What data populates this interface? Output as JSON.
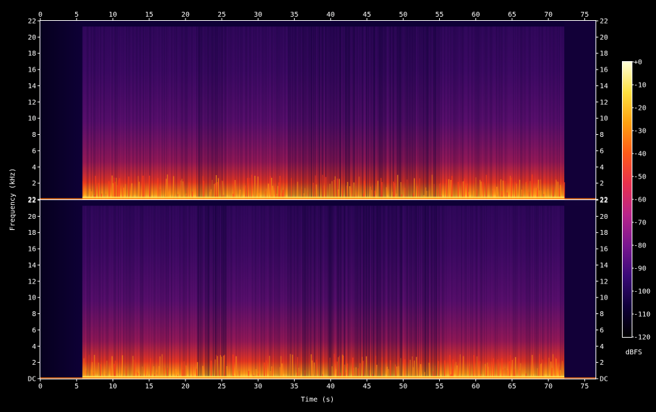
{
  "chart_data": {
    "type": "heatmap",
    "xlabel": "Time (s)",
    "ylabel": "Frequency (kHz)",
    "colorbar_label": "dBFS",
    "x_ticks": [
      "0",
      "5",
      "10",
      "15",
      "20",
      "25",
      "30",
      "35",
      "40",
      "45",
      "50",
      "55",
      "60",
      "65",
      "70",
      "75"
    ],
    "xlim": [
      0,
      76.5
    ],
    "channels": [
      {
        "y_ticks": [
          "DC",
          "2",
          "4",
          "6",
          "8",
          "10",
          "12",
          "14",
          "16",
          "18",
          "20",
          "22"
        ]
      },
      {
        "y_ticks": [
          "22",
          "2",
          "4",
          "6",
          "8",
          "10",
          "12",
          "14",
          "16",
          "18",
          "20",
          "22"
        ]
      }
    ],
    "ylim_khz": [
      0,
      22
    ],
    "colorbar_ticks": [
      "+0",
      "-10",
      "-20",
      "-30",
      "-40",
      "-50",
      "-60",
      "-70",
      "-80",
      "-90",
      "-100",
      "-110",
      "-120"
    ],
    "colorbar_range_db": [
      -120,
      0
    ],
    "signal_start_s": 5.8,
    "signal_end_s": 72.2,
    "colormap": [
      "#000000",
      "#10003a",
      "#3a0a78",
      "#7a1690",
      "#b8248a",
      "#e8304e",
      "#ff5a18",
      "#ffa010",
      "#ffe040",
      "#ffffd8"
    ]
  }
}
